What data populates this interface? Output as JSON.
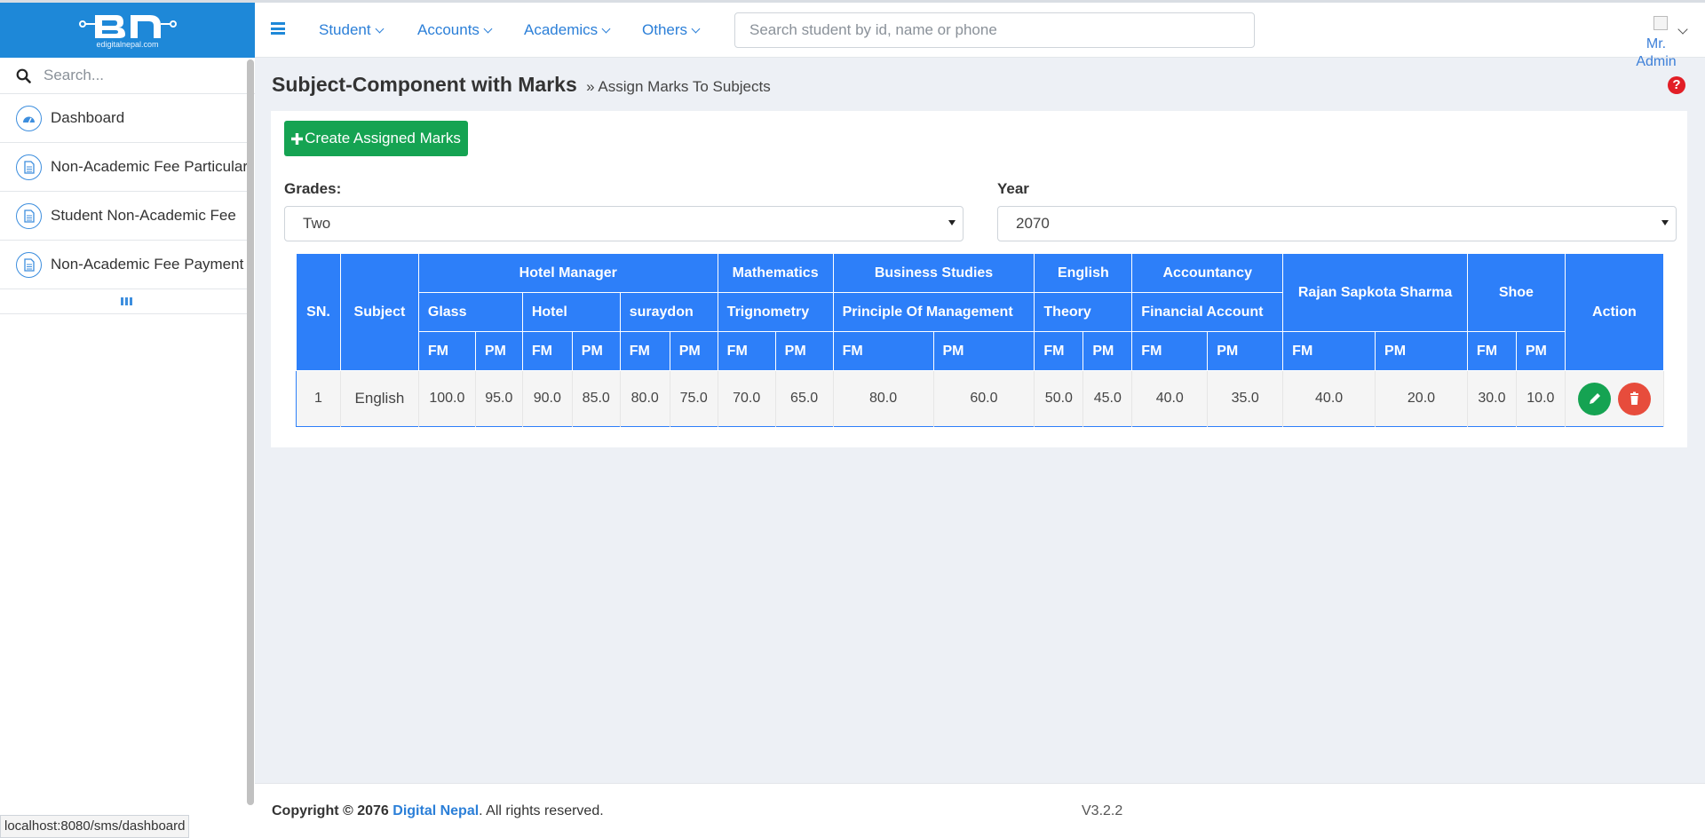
{
  "logo": {
    "subtitle": "edigitalnepal.com"
  },
  "nav": {
    "menus": [
      "Student",
      "Accounts",
      "Academics",
      "Others"
    ],
    "search_placeholder": "Search student by id, name or phone",
    "user_line1": "Mr.",
    "user_line2": "Admin"
  },
  "sidebar": {
    "search_placeholder": "Search...",
    "items": [
      {
        "label": "Dashboard",
        "icon": "dashboard-icon"
      },
      {
        "label": "Non-Academic Fee Particular",
        "icon": "document-icon"
      },
      {
        "label": "Student Non-Academic Fee",
        "icon": "document-icon"
      },
      {
        "label": "Non-Academic Fee Payment",
        "icon": "document-icon"
      }
    ]
  },
  "page": {
    "title": "Subject-Component with Marks",
    "crumb_sep": "»",
    "crumb": "Assign Marks To Subjects",
    "help": "?",
    "create_label": "Create Assigned Marks",
    "grades_label": "Grades:",
    "grades_value": "Two",
    "year_label": "Year",
    "year_value": "2070"
  },
  "table": {
    "sn": "SN.",
    "subject": "Subject",
    "action": "Action",
    "fm": "FM",
    "pm": "PM",
    "groups": [
      "Hotel Manager",
      "Mathematics",
      "Business Studies",
      "English",
      "Accountancy",
      "Rajan Sapkota Sharma",
      "Shoe"
    ],
    "components": [
      "Glass",
      "Hotel",
      "suraydon",
      "Trignometry",
      "Principle Of Management",
      "Theory",
      "Financial Account"
    ],
    "row": {
      "sn": "1",
      "subject": "English",
      "marks": [
        "100.0",
        "95.0",
        "90.0",
        "85.0",
        "80.0",
        "75.0",
        "70.0",
        "65.0",
        "80.0",
        "60.0",
        "50.0",
        "45.0",
        "40.0",
        "35.0",
        "40.0",
        "20.0",
        "30.0",
        "10.0"
      ]
    }
  },
  "footer": {
    "copy_prefix": "Copyright © 2076 ",
    "brand": "Digital Nepal",
    "copy_suffix": ". All rights reserved.",
    "version": "V3.2.2"
  },
  "status_url": "localhost:8080/sms/dashboard",
  "colors": {
    "primary": "#1e88d8",
    "table_header": "#2d7ff9",
    "create": "#15a352",
    "edit": "#15a352",
    "delete": "#e74c3c"
  }
}
